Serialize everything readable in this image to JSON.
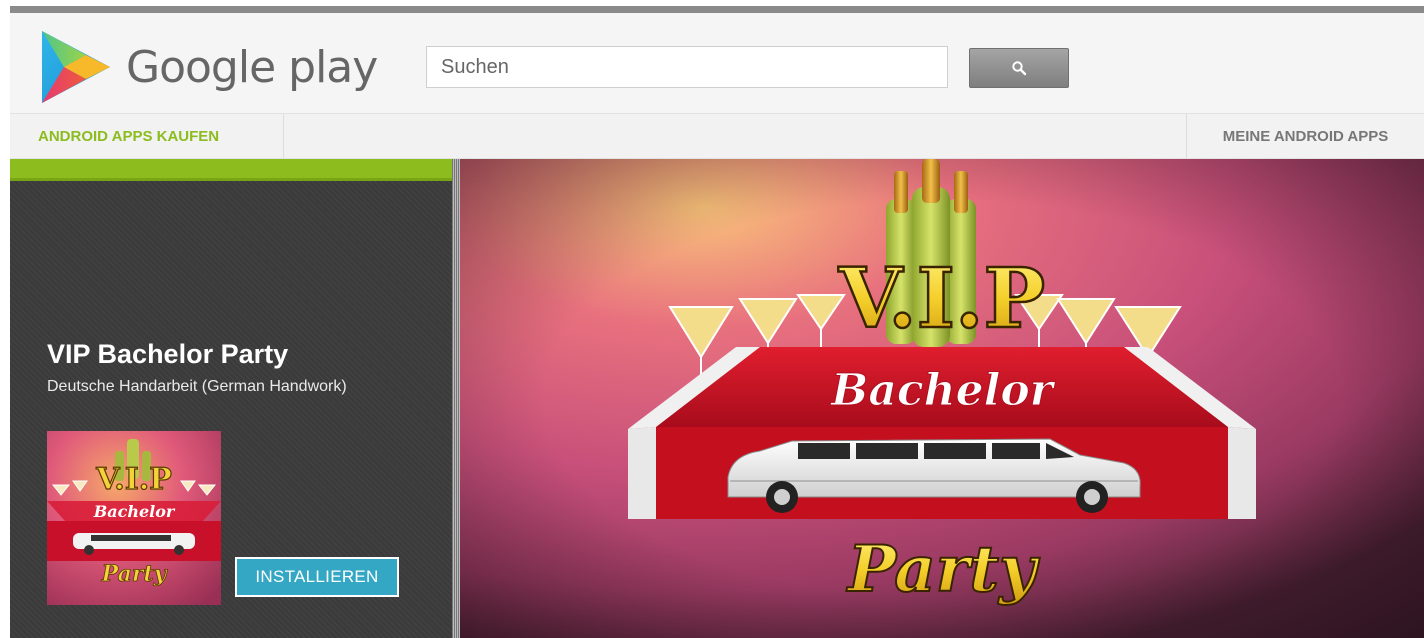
{
  "header": {
    "logo_text": "Google play",
    "search": {
      "placeholder": "Suchen",
      "value": ""
    },
    "search_icon": "search-icon"
  },
  "nav": {
    "left_label": "ANDROID APPS KAUFEN",
    "right_label": "MEINE ANDROID APPS"
  },
  "app": {
    "title": "VIP Bachelor Party",
    "developer": "Deutsche Handarbeit (German Handwork)",
    "install_label": "INSTALLIEREN"
  },
  "artwork": {
    "vip_text": "V.I.P",
    "bachelor_text": "Bachelor",
    "party_text": "Party"
  },
  "colors": {
    "accent_green": "#8cbc1e",
    "install_blue": "#33a7c4",
    "panel_dark": "#3b3b3b"
  }
}
